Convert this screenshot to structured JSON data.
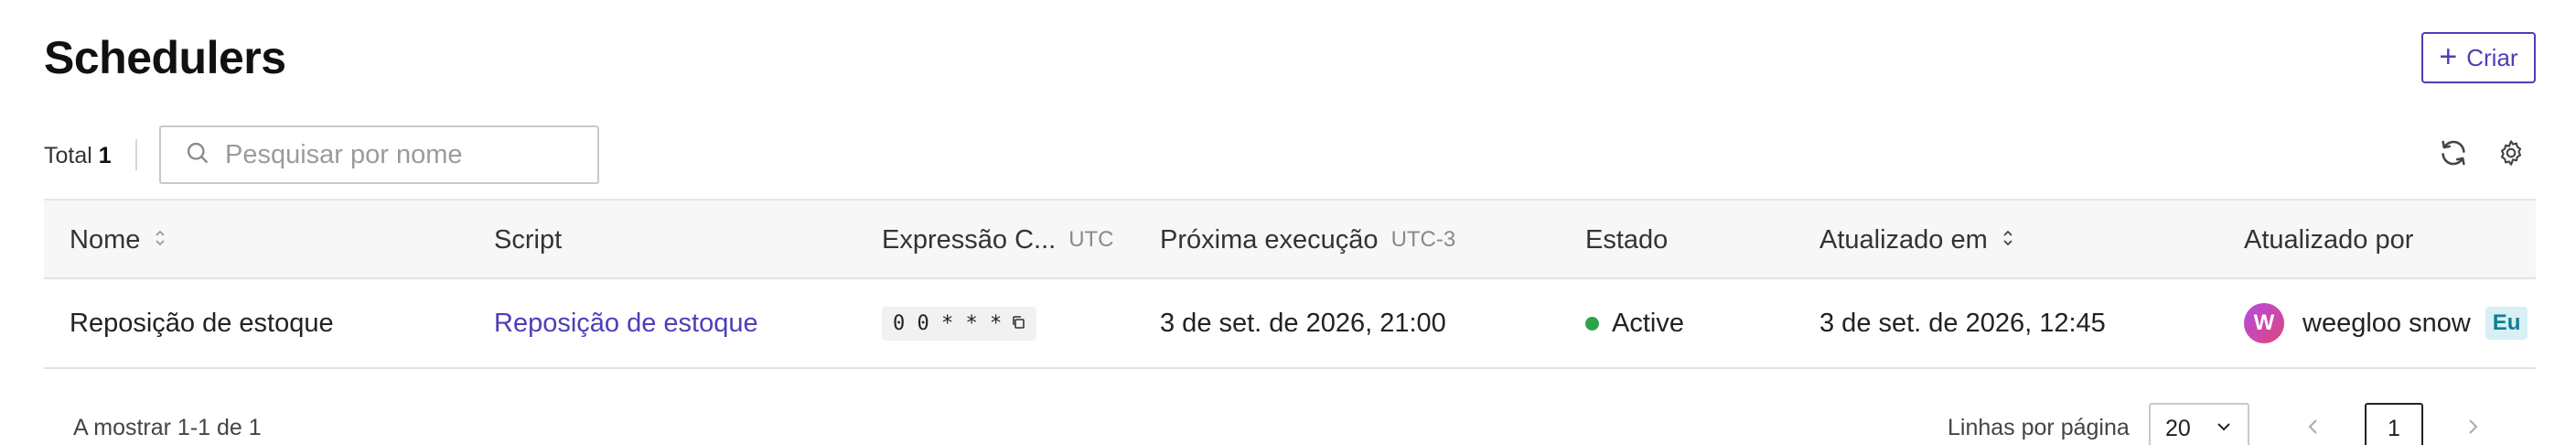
{
  "page": {
    "title": "Schedulers"
  },
  "toolbar": {
    "create_label": "Criar",
    "total_label": "Total",
    "total_count": "1",
    "search_placeholder": "Pesquisar por nome"
  },
  "table": {
    "columns": [
      {
        "label": "Nome",
        "sortable": true
      },
      {
        "label": "Script"
      },
      {
        "label": "Expressão C...",
        "timezone": "UTC"
      },
      {
        "label": "Próxima execução",
        "timezone": "UTC-3"
      },
      {
        "label": "Estado"
      },
      {
        "label": "Atualizado em",
        "sortable": true,
        "sort": "desc"
      },
      {
        "label": "Atualizado por"
      }
    ],
    "rows": [
      {
        "name": "Reposição de estoque",
        "script": "Reposição de estoque",
        "cron": "0 0 * * *",
        "next_run": "3 de set. de 2026, 21:00",
        "state": "Active",
        "updated_at": "3 de set. de 2026, 12:45",
        "updated_by": "weegloo snow",
        "avatar_letter": "W",
        "me_badge": "Eu"
      }
    ]
  },
  "pagination": {
    "range_text": "A mostrar 1-1 de 1",
    "rows_per_page_label": "Linhas por página",
    "rows_per_page_value": "20",
    "current_page": "1"
  },
  "icons": {
    "create": "plus-icon",
    "search": "search-icon",
    "refresh": "refresh-icon",
    "settings": "gear-icon",
    "sort": "sort-icon",
    "copy": "copy-icon",
    "prev": "chevron-left-icon",
    "next": "chevron-right-icon",
    "dropdown": "chevron-down-icon"
  },
  "colors": {
    "accent": "#4d3fb8",
    "status_active": "#2ca34a",
    "me_badge_bg": "#d8f0f4"
  }
}
